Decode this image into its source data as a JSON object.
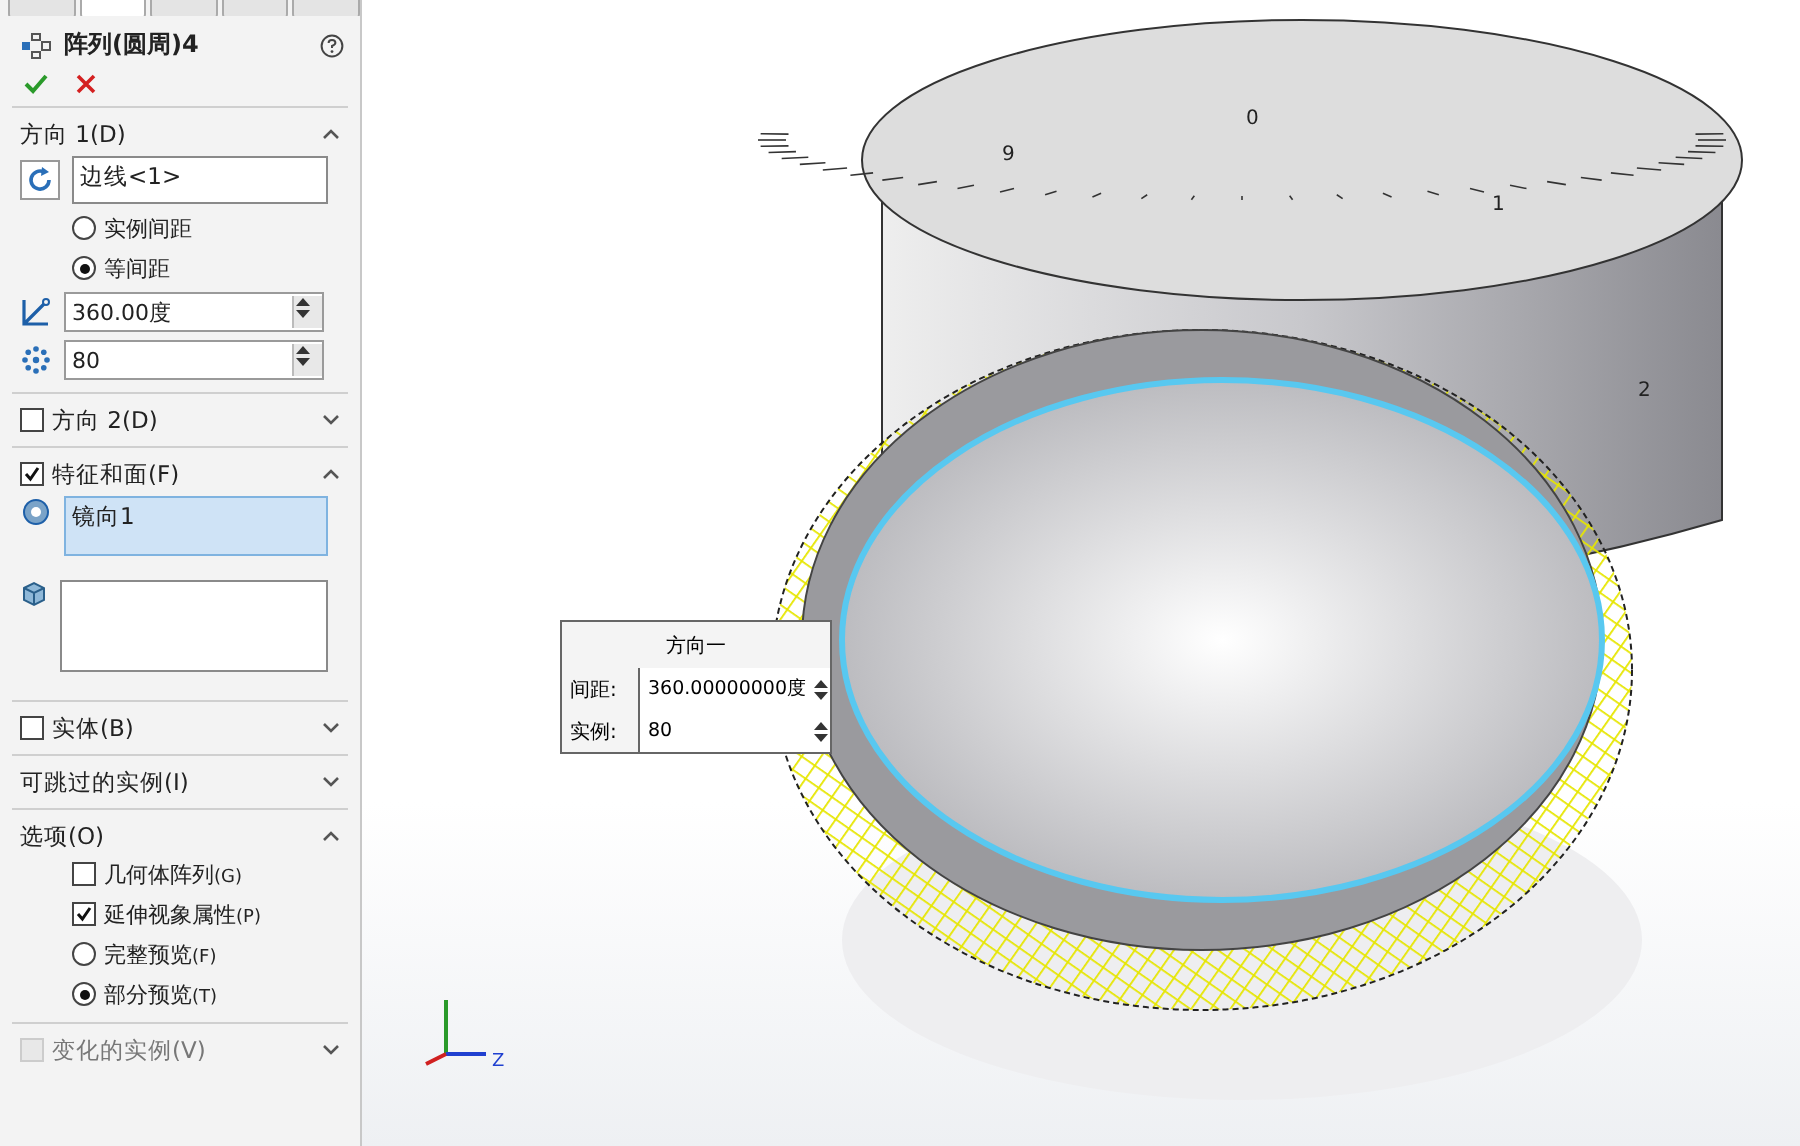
{
  "tabs": [
    {
      "selected": false
    },
    {
      "selected": true
    },
    {
      "selected": false
    },
    {
      "selected": false
    },
    {
      "selected": false
    }
  ],
  "feature": {
    "title": "阵列(圆周)4"
  },
  "sections": [
    {
      "kind": "direction",
      "title": "方向 1(D)",
      "expanded": true,
      "edge_field": "边线<1>",
      "radios": [
        {
          "label": "实例间距",
          "selected": false
        },
        {
          "label": "等间距",
          "selected": true
        }
      ],
      "angle": "360.00度",
      "count": "80"
    },
    {
      "kind": "header",
      "title": "方向 2(D)",
      "checked": false,
      "expanded": false
    },
    {
      "kind": "features",
      "title": "特征和面(F)",
      "checked": true,
      "expanded": true,
      "features_list": "镜向1"
    },
    {
      "kind": "header",
      "title": "实体(B)",
      "checked": false,
      "expanded": false
    },
    {
      "kind": "plain",
      "title": "可跳过的实例(I)",
      "expanded": false
    },
    {
      "kind": "options",
      "title": "选项(O)",
      "expanded": true,
      "checks": [
        {
          "label": "几何体阵列",
          "hotkey": "(G)",
          "checked": false
        },
        {
          "label": "延伸视象属性",
          "hotkey": "(P)",
          "checked": true
        }
      ],
      "radios": [
        {
          "label": "完整预览",
          "hotkey": "(F)",
          "selected": false
        },
        {
          "label": "部分预览",
          "hotkey": "(T)",
          "selected": true
        }
      ]
    },
    {
      "kind": "header",
      "title": "变化的实例(V)",
      "checked": false,
      "disabled": true,
      "expanded": false
    }
  ],
  "scale_numbers": [
    "9",
    "0",
    "1",
    "2"
  ],
  "popup": {
    "title": "方向一",
    "rows": [
      {
        "label": "间距:",
        "value": "360.00000000度"
      },
      {
        "label": "实例:",
        "value": "80"
      }
    ]
  },
  "triad": {
    "label": "Z"
  }
}
